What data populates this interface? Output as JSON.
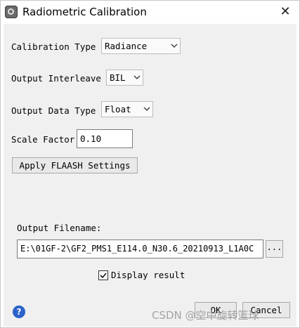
{
  "window": {
    "title": "Radiometric Calibration"
  },
  "fields": {
    "calibration_type": {
      "label": "Calibration Type",
      "value": "Radiance"
    },
    "output_interleave": {
      "label": "Output Interleave",
      "value": "BIL"
    },
    "output_data_type": {
      "label": "Output Data Type",
      "value": "Float"
    },
    "scale_factor": {
      "label": "Scale Factor",
      "value": "0.10"
    }
  },
  "buttons": {
    "apply_flaash": "Apply FLAASH Settings",
    "browse": "...",
    "ok": "OK",
    "cancel": "Cancel"
  },
  "output": {
    "filename_label": "Output Filename:",
    "filename_value": "E:\\01GF-2\\GF2_PMS1_E114.0_N30.6_20210913_L1A0C"
  },
  "display_result": {
    "label": "Display result",
    "checked": true
  },
  "help": {
    "glyph": "?"
  },
  "watermark": "CSDN @空中旋转篮球",
  "icons": [
    "app-icon",
    "close-icon",
    "chevron-down-icon",
    "check-icon",
    "help-icon"
  ]
}
